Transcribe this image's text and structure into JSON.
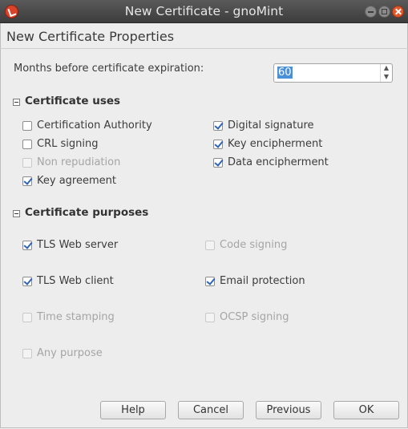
{
  "window": {
    "title": "New Certificate - gnoMint"
  },
  "heading": "New Certificate Properties",
  "expiration": {
    "label": "Months before certificate expiration:",
    "value": "60"
  },
  "uses": {
    "title": "Certificate uses",
    "items": [
      {
        "label": "Certification Authority",
        "checked": false,
        "enabled": true
      },
      {
        "label": "CRL signing",
        "checked": false,
        "enabled": true
      },
      {
        "label": "Non repudiation",
        "checked": false,
        "enabled": false
      },
      {
        "label": "Key agreement",
        "checked": true,
        "enabled": true
      },
      {
        "label": "Digital signature",
        "checked": true,
        "enabled": true
      },
      {
        "label": "Key encipherment",
        "checked": true,
        "enabled": true
      },
      {
        "label": "Data encipherment",
        "checked": true,
        "enabled": true
      }
    ]
  },
  "purposes": {
    "title": "Certificate purposes",
    "items": [
      {
        "label": "TLS Web server",
        "checked": true,
        "enabled": true
      },
      {
        "label": "TLS Web client",
        "checked": true,
        "enabled": true
      },
      {
        "label": "Time stamping",
        "checked": false,
        "enabled": false
      },
      {
        "label": "Any purpose",
        "checked": false,
        "enabled": false
      },
      {
        "label": "Code signing",
        "checked": false,
        "enabled": false
      },
      {
        "label": "Email protection",
        "checked": true,
        "enabled": true
      },
      {
        "label": "OCSP signing",
        "checked": false,
        "enabled": false
      }
    ]
  },
  "buttons": {
    "help": "Help",
    "cancel": "Cancel",
    "previous": "Previous",
    "ok": "OK"
  }
}
